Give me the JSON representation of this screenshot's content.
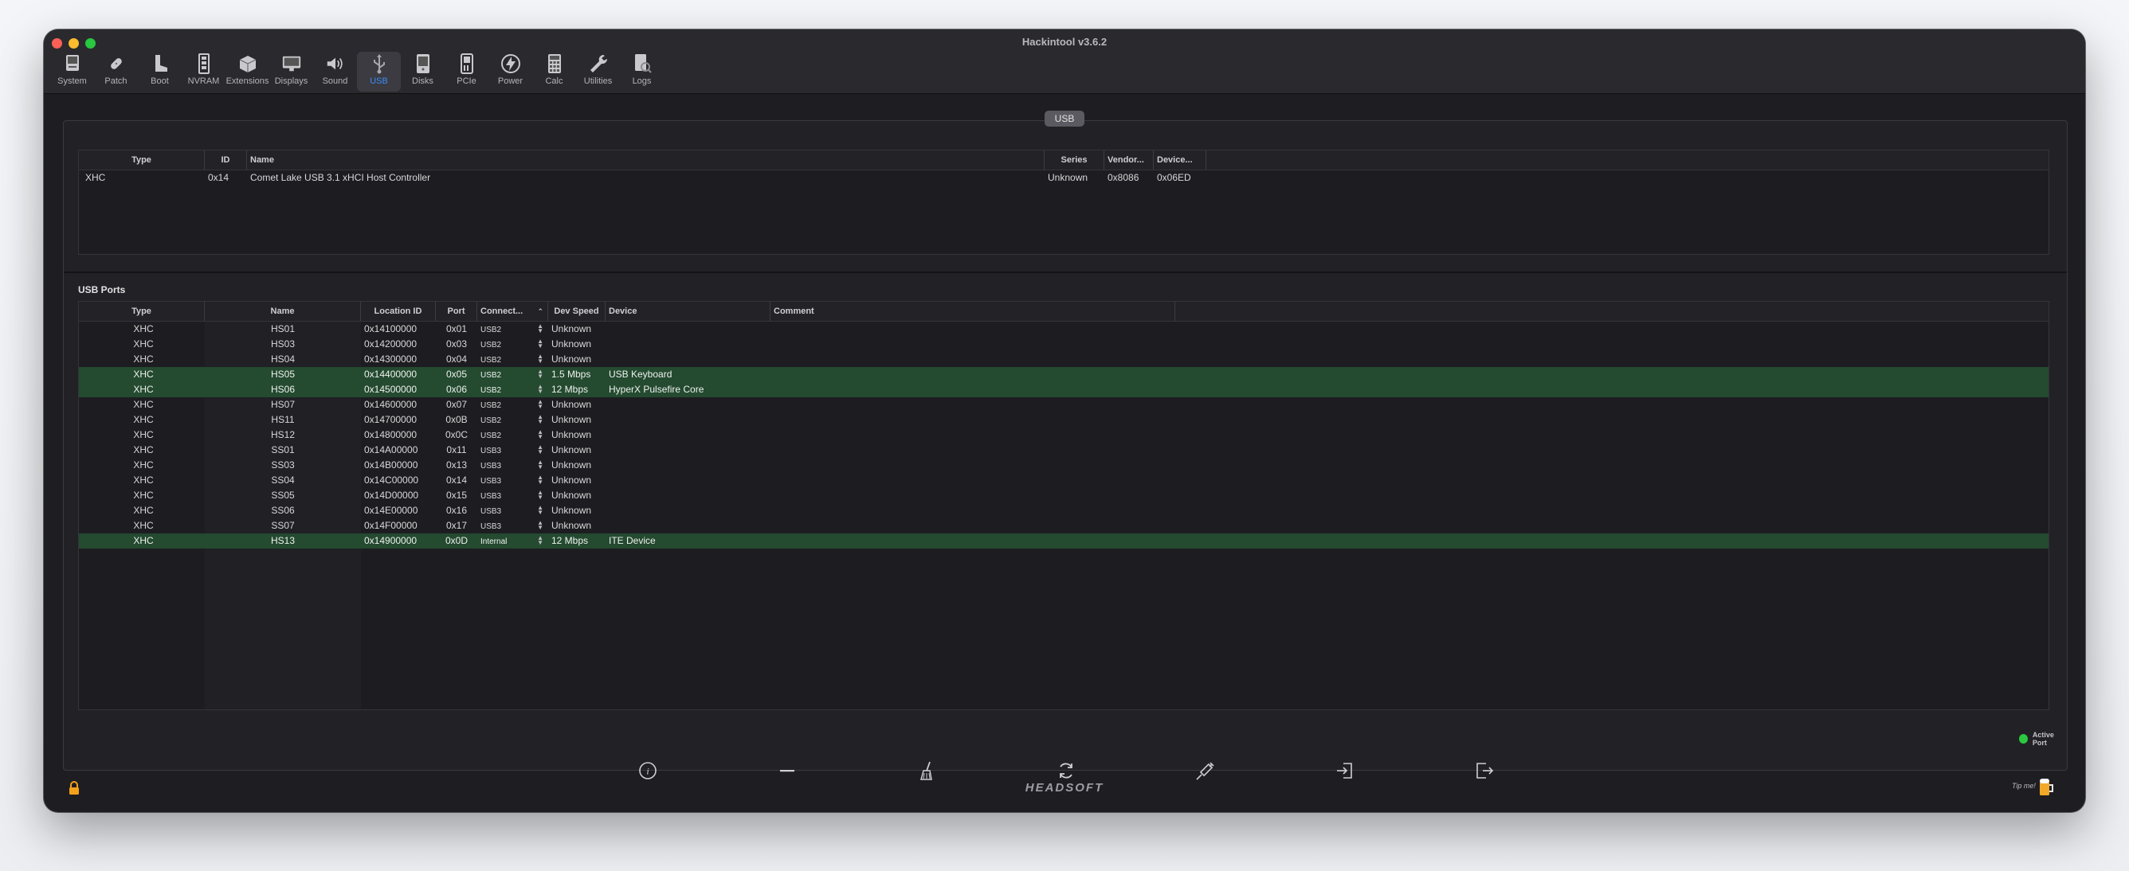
{
  "window": {
    "title": "Hackintool v3.6.2"
  },
  "toolbar": {
    "items": [
      {
        "label": "System",
        "icon": "system-icon"
      },
      {
        "label": "Patch",
        "icon": "patch-icon"
      },
      {
        "label": "Boot",
        "icon": "boot-icon"
      },
      {
        "label": "NVRAM",
        "icon": "nvram-icon"
      },
      {
        "label": "Extensions",
        "icon": "extensions-icon"
      },
      {
        "label": "Displays",
        "icon": "displays-icon"
      },
      {
        "label": "Sound",
        "icon": "sound-icon"
      },
      {
        "label": "USB",
        "icon": "usb-icon",
        "active": true
      },
      {
        "label": "Disks",
        "icon": "disks-icon"
      },
      {
        "label": "PCIe",
        "icon": "pcie-icon"
      },
      {
        "label": "Power",
        "icon": "power-icon"
      },
      {
        "label": "Calc",
        "icon": "calc-icon"
      },
      {
        "label": "Utilities",
        "icon": "utilities-icon"
      },
      {
        "label": "Logs",
        "icon": "logs-icon"
      }
    ]
  },
  "usb_section_label": "USB",
  "controllers": {
    "columns": [
      "Type",
      "ID",
      "Name",
      "Series",
      "Vendor...",
      "Device..."
    ],
    "rows": [
      {
        "type": "XHC",
        "id": "0x14",
        "name": "Comet Lake USB 3.1 xHCI Host Controller",
        "series": "Unknown",
        "vendor": "0x8086",
        "device": "0x06ED"
      }
    ]
  },
  "usb_ports": {
    "title": "USB Ports",
    "columns": [
      "Type",
      "Name",
      "Location ID",
      "Port",
      "Connect...",
      "Dev Speed",
      "Device",
      "Comment"
    ],
    "rows": [
      {
        "type": "XHC",
        "name": "HS01",
        "location_id": "0x14100000",
        "port": "0x01",
        "connector": "USB2",
        "speed": "Unknown",
        "device": "",
        "comment": "",
        "active": false
      },
      {
        "type": "XHC",
        "name": "HS03",
        "location_id": "0x14200000",
        "port": "0x03",
        "connector": "USB2",
        "speed": "Unknown",
        "device": "",
        "comment": "",
        "active": false
      },
      {
        "type": "XHC",
        "name": "HS04",
        "location_id": "0x14300000",
        "port": "0x04",
        "connector": "USB2",
        "speed": "Unknown",
        "device": "",
        "comment": "",
        "active": false
      },
      {
        "type": "XHC",
        "name": "HS05",
        "location_id": "0x14400000",
        "port": "0x05",
        "connector": "USB2",
        "speed": "1.5 Mbps",
        "device": "USB Keyboard",
        "comment": "",
        "active": true
      },
      {
        "type": "XHC",
        "name": "HS06",
        "location_id": "0x14500000",
        "port": "0x06",
        "connector": "USB2",
        "speed": "12 Mbps",
        "device": "HyperX Pulsefire Core",
        "comment": "",
        "active": true
      },
      {
        "type": "XHC",
        "name": "HS07",
        "location_id": "0x14600000",
        "port": "0x07",
        "connector": "USB2",
        "speed": "Unknown",
        "device": "",
        "comment": "",
        "active": false
      },
      {
        "type": "XHC",
        "name": "HS11",
        "location_id": "0x14700000",
        "port": "0x0B",
        "connector": "USB2",
        "speed": "Unknown",
        "device": "",
        "comment": "",
        "active": false
      },
      {
        "type": "XHC",
        "name": "HS12",
        "location_id": "0x14800000",
        "port": "0x0C",
        "connector": "USB2",
        "speed": "Unknown",
        "device": "",
        "comment": "",
        "active": false
      },
      {
        "type": "XHC",
        "name": "SS01",
        "location_id": "0x14A00000",
        "port": "0x11",
        "connector": "USB3",
        "speed": "Unknown",
        "device": "",
        "comment": "",
        "active": false
      },
      {
        "type": "XHC",
        "name": "SS03",
        "location_id": "0x14B00000",
        "port": "0x13",
        "connector": "USB3",
        "speed": "Unknown",
        "device": "",
        "comment": "",
        "active": false
      },
      {
        "type": "XHC",
        "name": "SS04",
        "location_id": "0x14C00000",
        "port": "0x14",
        "connector": "USB3",
        "speed": "Unknown",
        "device": "",
        "comment": "",
        "active": false
      },
      {
        "type": "XHC",
        "name": "SS05",
        "location_id": "0x14D00000",
        "port": "0x15",
        "connector": "USB3",
        "speed": "Unknown",
        "device": "",
        "comment": "",
        "active": false
      },
      {
        "type": "XHC",
        "name": "SS06",
        "location_id": "0x14E00000",
        "port": "0x16",
        "connector": "USB3",
        "speed": "Unknown",
        "device": "",
        "comment": "",
        "active": false
      },
      {
        "type": "XHC",
        "name": "SS07",
        "location_id": "0x14F00000",
        "port": "0x17",
        "connector": "USB3",
        "speed": "Unknown",
        "device": "",
        "comment": "",
        "active": false
      },
      {
        "type": "XHC",
        "name": "HS13",
        "location_id": "0x14900000",
        "port": "0x0D",
        "connector": "Internal",
        "speed": "12 Mbps",
        "device": "ITE Device",
        "comment": "",
        "active": true
      }
    ]
  },
  "legend": {
    "label": "Active Port",
    "color": "#2bc840"
  },
  "actions": [
    {
      "name": "info",
      "icon": "info-icon"
    },
    {
      "name": "remove",
      "icon": "minus-icon"
    },
    {
      "name": "clear",
      "icon": "broom-icon"
    },
    {
      "name": "refresh",
      "icon": "refresh-icon"
    },
    {
      "name": "inject",
      "icon": "syringe-icon"
    },
    {
      "name": "import",
      "icon": "import-icon"
    },
    {
      "name": "export",
      "icon": "export-icon"
    }
  ],
  "footer": {
    "brand": "HEADSOFT",
    "tip": "Tip me!",
    "lock_icon": "lock-icon",
    "beer_icon": "beer-icon"
  },
  "colors": {
    "accent": "#3d8bf5",
    "active_row": "#244a30"
  }
}
